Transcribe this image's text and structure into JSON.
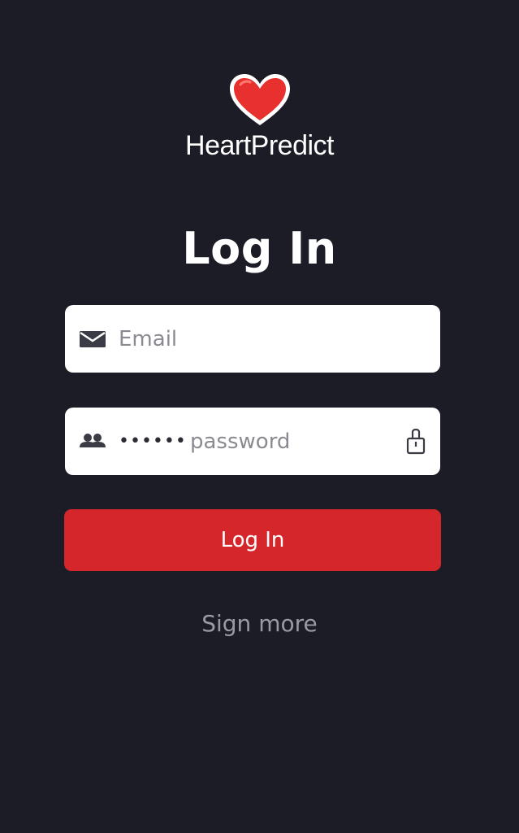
{
  "brand": {
    "name": "HeartPredict",
    "logo_icon": "heart-icon",
    "logo_color": "#e8302e"
  },
  "page": {
    "title": "Log In",
    "background_color": "#1b1c26"
  },
  "form": {
    "email": {
      "icon": "envelope-icon",
      "placeholder": "Email",
      "value": ""
    },
    "password": {
      "icon": "users-icon",
      "masked_value": "••••••",
      "placeholder": "password",
      "reveal_icon": "lock-icon"
    },
    "submit_label": "Log In",
    "submit_color": "#d5262c"
  },
  "links": {
    "secondary_label": "Sign more"
  }
}
